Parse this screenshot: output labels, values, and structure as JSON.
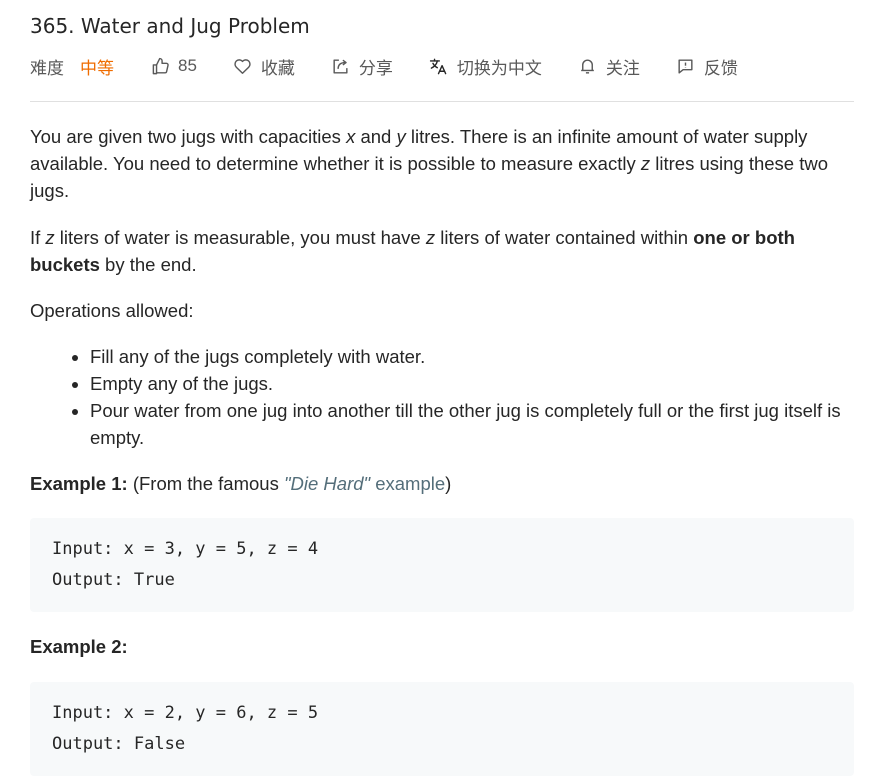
{
  "problem": {
    "title": "365. Water and Jug Problem"
  },
  "meta": {
    "difficulty_label": "难度",
    "difficulty_value": "中等",
    "likes": "85",
    "favorite_label": "收藏",
    "share_label": "分享",
    "language_label": "切换为中文",
    "follow_label": "关注",
    "feedback_label": "反馈",
    "difficulty_color": "#ef6c00"
  },
  "content": {
    "p1_a": "You are given two jugs with capacities ",
    "p1_x": "x",
    "p1_b": " and ",
    "p1_y": "y",
    "p1_c": " litres. There is an infinite amount of water supply available. You need to determine whether it is possible to measure exactly ",
    "p1_z": "z",
    "p1_d": " litres using these two jugs.",
    "p2_a": "If ",
    "p2_z1": "z",
    "p2_b": " liters of water is measurable, you must have ",
    "p2_z2": "z",
    "p2_c": " liters of water contained within ",
    "p2_bold": "one or both buckets",
    "p2_d": " by the end.",
    "p3": "Operations allowed:",
    "operations": [
      "Fill any of the jugs completely with water.",
      "Empty any of the jugs.",
      "Pour water from one jug into another till the other jug is completely full or the first jug itself is empty."
    ]
  },
  "examples": [
    {
      "title": "Example 1:",
      "note_prefix": " (From the famous ",
      "link_italic": "\"Die Hard\"",
      "link_rest": " example",
      "note_suffix": ")",
      "input": "Input: x = 3, y = 5, z = 4",
      "output": "Output: True"
    },
    {
      "title": "Example 2:",
      "input": "Input: x = 2, y = 6, z = 5",
      "output": "Output: False"
    }
  ]
}
